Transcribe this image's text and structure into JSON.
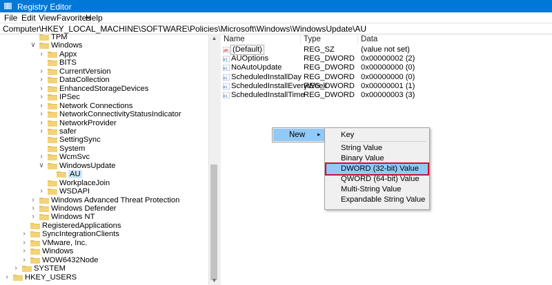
{
  "window": {
    "title": "Registry Editor"
  },
  "menu": {
    "file": "File",
    "edit": "Edit",
    "view": "View",
    "favorites": "Favorites",
    "help": "Help"
  },
  "address": {
    "path": "Computer\\HKEY_LOCAL_MACHINE\\SOFTWARE\\Policies\\Microsoft\\Windows\\WindowsUpdate\\AU"
  },
  "tree": [
    {
      "label": "TPM",
      "expander": ""
    },
    {
      "label": "Windows",
      "expander": "v"
    },
    {
      "label": "Appx",
      "expander": ">"
    },
    {
      "label": "BITS",
      "expander": ""
    },
    {
      "label": "CurrentVersion",
      "expander": ">"
    },
    {
      "label": "DataCollection",
      "expander": ">"
    },
    {
      "label": "EnhancedStorageDevices",
      "expander": ">"
    },
    {
      "label": "IPSec",
      "expander": ">"
    },
    {
      "label": "Network Connections",
      "expander": ">"
    },
    {
      "label": "NetworkConnectivityStatusIndicator",
      "expander": ">"
    },
    {
      "label": "NetworkProvider",
      "expander": ">"
    },
    {
      "label": "safer",
      "expander": ">"
    },
    {
      "label": "SettingSync",
      "expander": ""
    },
    {
      "label": "System",
      "expander": ""
    },
    {
      "label": "WcmSvc",
      "expander": ">"
    },
    {
      "label": "WindowsUpdate",
      "expander": "v"
    },
    {
      "label": "AU",
      "expander": ""
    },
    {
      "label": "WorkplaceJoin",
      "expander": ""
    },
    {
      "label": "WSDAPI",
      "expander": ">"
    },
    {
      "label": "Windows Advanced Threat Protection",
      "expander": ">"
    },
    {
      "label": "Windows Defender",
      "expander": ">"
    },
    {
      "label": "Windows NT",
      "expander": ">"
    },
    {
      "label": "RegisteredApplications",
      "expander": ""
    },
    {
      "label": "SyncIntegrationClients",
      "expander": ">"
    },
    {
      "label": "VMware, Inc.",
      "expander": ">"
    },
    {
      "label": "Windows",
      "expander": ">"
    },
    {
      "label": "WOW6432Node",
      "expander": ">"
    },
    {
      "label": "SYSTEM",
      "expander": ">"
    },
    {
      "label": "HKEY_USERS",
      "expander": ">"
    }
  ],
  "columns": {
    "name": "Name",
    "type": "Type",
    "data": "Data"
  },
  "values": [
    {
      "name": "(Default)",
      "type": "REG_SZ",
      "data": "(value not set)",
      "icon": "string-value-icon"
    },
    {
      "name": "AUOptions",
      "type": "REG_DWORD",
      "data": "0x00000002 (2)",
      "icon": "dword-value-icon"
    },
    {
      "name": "NoAutoUpdate",
      "type": "REG_DWORD",
      "data": "0x00000000 (0)",
      "icon": "dword-value-icon"
    },
    {
      "name": "ScheduledInstallDay",
      "type": "REG_DWORD",
      "data": "0x00000000 (0)",
      "icon": "dword-value-icon"
    },
    {
      "name": "ScheduledInstallEveryWeek",
      "type": "REG_DWORD",
      "data": "0x00000001 (1)",
      "icon": "dword-value-icon"
    },
    {
      "name": "ScheduledInstallTime",
      "type": "REG_DWORD",
      "data": "0x00000003 (3)",
      "icon": "dword-value-icon"
    }
  ],
  "context_menu": {
    "new_label": "New"
  },
  "submenu": {
    "items": [
      "Key",
      "String Value",
      "Binary Value",
      "DWORD (32-bit) Value",
      "QWORD (64-bit) Value",
      "Multi-String Value",
      "Expandable String Value"
    ],
    "highlighted": "DWORD (32-bit) Value"
  },
  "colors": {
    "titlebar": "#0078d7",
    "menu_highlight": "#91c9f7",
    "annotation_red": "#c8102e",
    "folder": "#e8c157"
  }
}
